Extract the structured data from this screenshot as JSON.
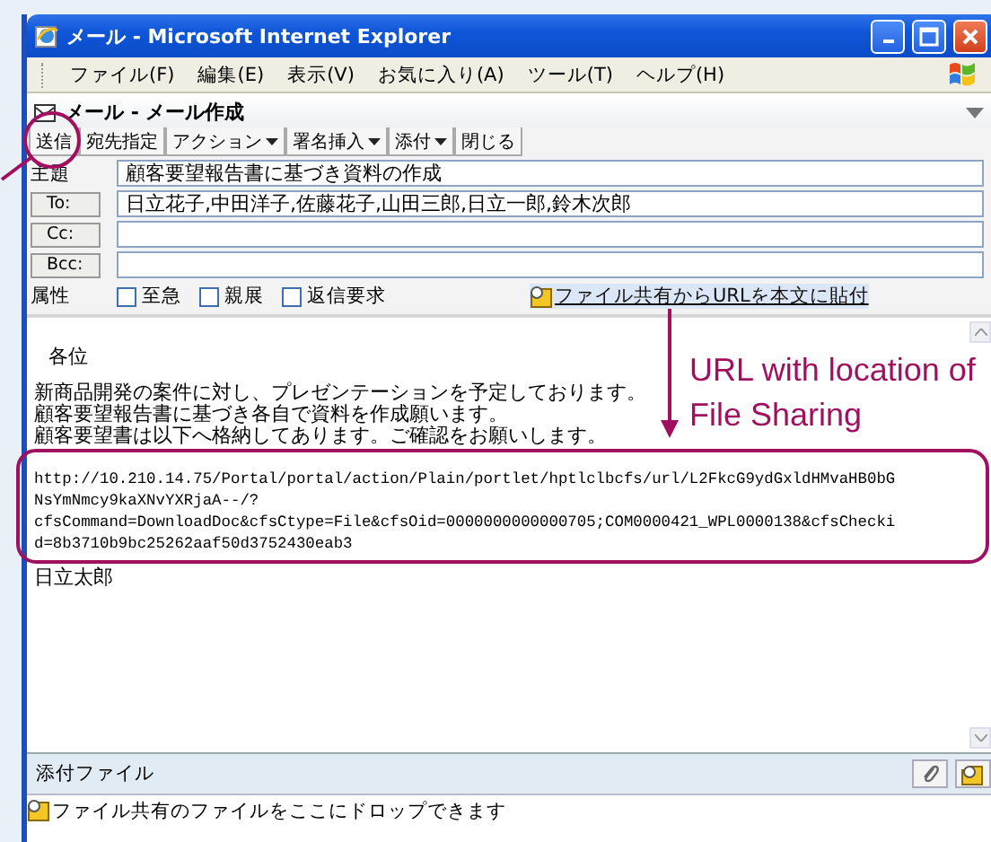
{
  "window": {
    "title": "メール - Microsoft Internet Explorer"
  },
  "menu": [
    "ファイル(F)",
    "編集(E)",
    "表示(V)",
    "お気に入り(A)",
    "ツール(T)",
    "ヘルプ(H)"
  ],
  "compose": {
    "title": "メール - メール作成"
  },
  "toolbar": [
    {
      "label": "送信",
      "dropdown": false
    },
    {
      "label": "宛先指定",
      "dropdown": false
    },
    {
      "label": "アクション",
      "dropdown": true
    },
    {
      "label": "署名挿入",
      "dropdown": true
    },
    {
      "label": "添付",
      "dropdown": true
    },
    {
      "label": "閉じる",
      "dropdown": false
    }
  ],
  "fields": [
    {
      "kind": "label",
      "label": "主題",
      "value": "顧客要望報告書に基づき資料の作成"
    },
    {
      "kind": "button",
      "label": "To:",
      "value": "日立花子,中田洋子,佐藤花子,山田三郎,日立一郎,鈴木次郎"
    },
    {
      "kind": "button",
      "label": "Cc:"
    },
    {
      "kind": "button",
      "label": "Bcc:"
    }
  ],
  "attributes": {
    "label": "属性",
    "options": [
      {
        "label": "至急",
        "checked": false
      },
      {
        "label": "親展",
        "checked": false
      },
      {
        "label": "返信要求",
        "checked": false
      }
    ]
  },
  "paste_link": "ファイル共有からURLを本文に貼付",
  "body": {
    "greeting": "各位",
    "paragraph": [
      "新商品開発の案件に対し、プレゼンテーションを予定しております。",
      "顧客要望報告書に基づき各自で資料を作成願います。",
      "顧客要望書は以下へ格納してあります。ご確認をお願いします。"
    ],
    "url_lines": [
      "http://10.210.14.75/Portal/portal/action/Plain/portlet/hptlclbcfs/url/L2FkcG9ydGxldHMvaHB0bG",
      "NsYmNmcy9kaXNvYXRjaA--/?",
      "cfsCommand=DownloadDoc&cfsCtype=File&cfsOid=0000000000000705;COM0000421_WPL0000138&cfsChecki",
      "d=8b3710b9bc25262aaf50d3752430eab3"
    ],
    "signature": "日立太郎"
  },
  "attachments": {
    "title": "添付ファイル",
    "drop_hint": "ファイル共有のファイルをここにドロップできます"
  },
  "annotation": "URL with location of File Sharing"
}
